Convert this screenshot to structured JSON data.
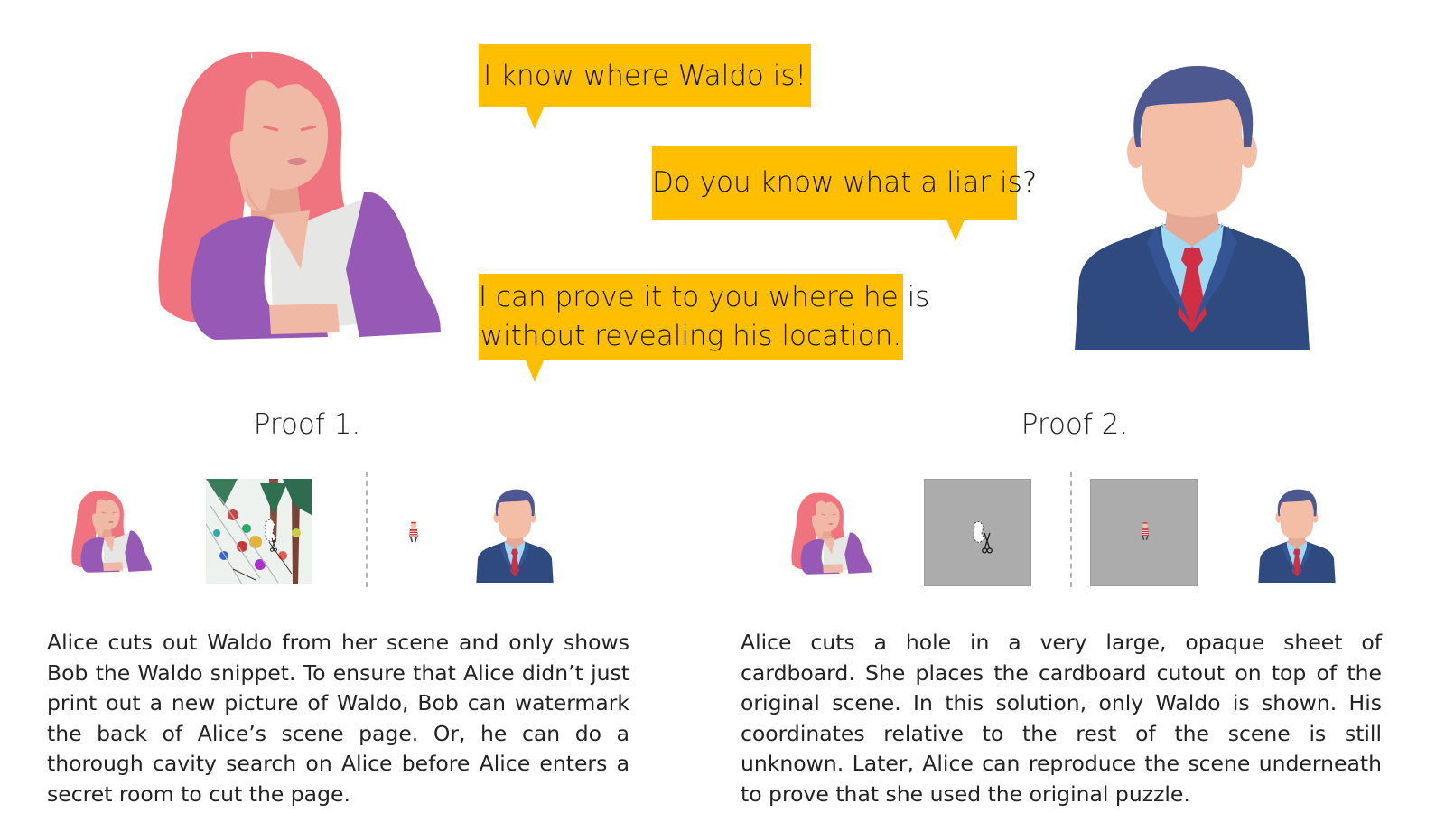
{
  "speech": {
    "alice_claim": "I know where Waldo is!",
    "bob_question": "Do you know what a liar is?",
    "alice_offer_line1": "I can prove it to you where he is",
    "alice_offer_line2": "without revealing his location."
  },
  "proof1": {
    "title": "Proof 1.",
    "description": "Alice cuts out Waldo from her scene and only shows Bob the Waldo snippet. To ensure that Alice didn’t just print out a new picture of Waldo, Bob can watermark the back of Alice’s scene page. Or, he can do a thorough cavity search on Alice before Alice enters a secret room to cut the page."
  },
  "proof2": {
    "title": "Proof 2.",
    "description": "Alice cuts a hole in a very large, opaque sheet of cardboard. She places the cardboard cutout on top of the original scene. In this solution, only Waldo is shown. His coordinates relative to the rest of the scene is still unknown. Later, Alice can reproduce the scene underneath to prove that she used the original puzzle."
  },
  "colors": {
    "bubble": "#ffbf00",
    "alice_hair": "#f07480",
    "alice_cardigan": "#9659b5",
    "alice_skin": "#f0b9a6",
    "bob_hair": "#4e5890",
    "bob_suit": "#2e4a7e",
    "bob_tie": "#d12e45",
    "bob_shirt": "#9fd9f2",
    "cardboard": "#acacac"
  },
  "icons": [
    "alice-avatar",
    "bob-avatar",
    "waldo-scene-image",
    "waldo-snippet-icon",
    "scissors-icon",
    "cardboard-sheet"
  ]
}
